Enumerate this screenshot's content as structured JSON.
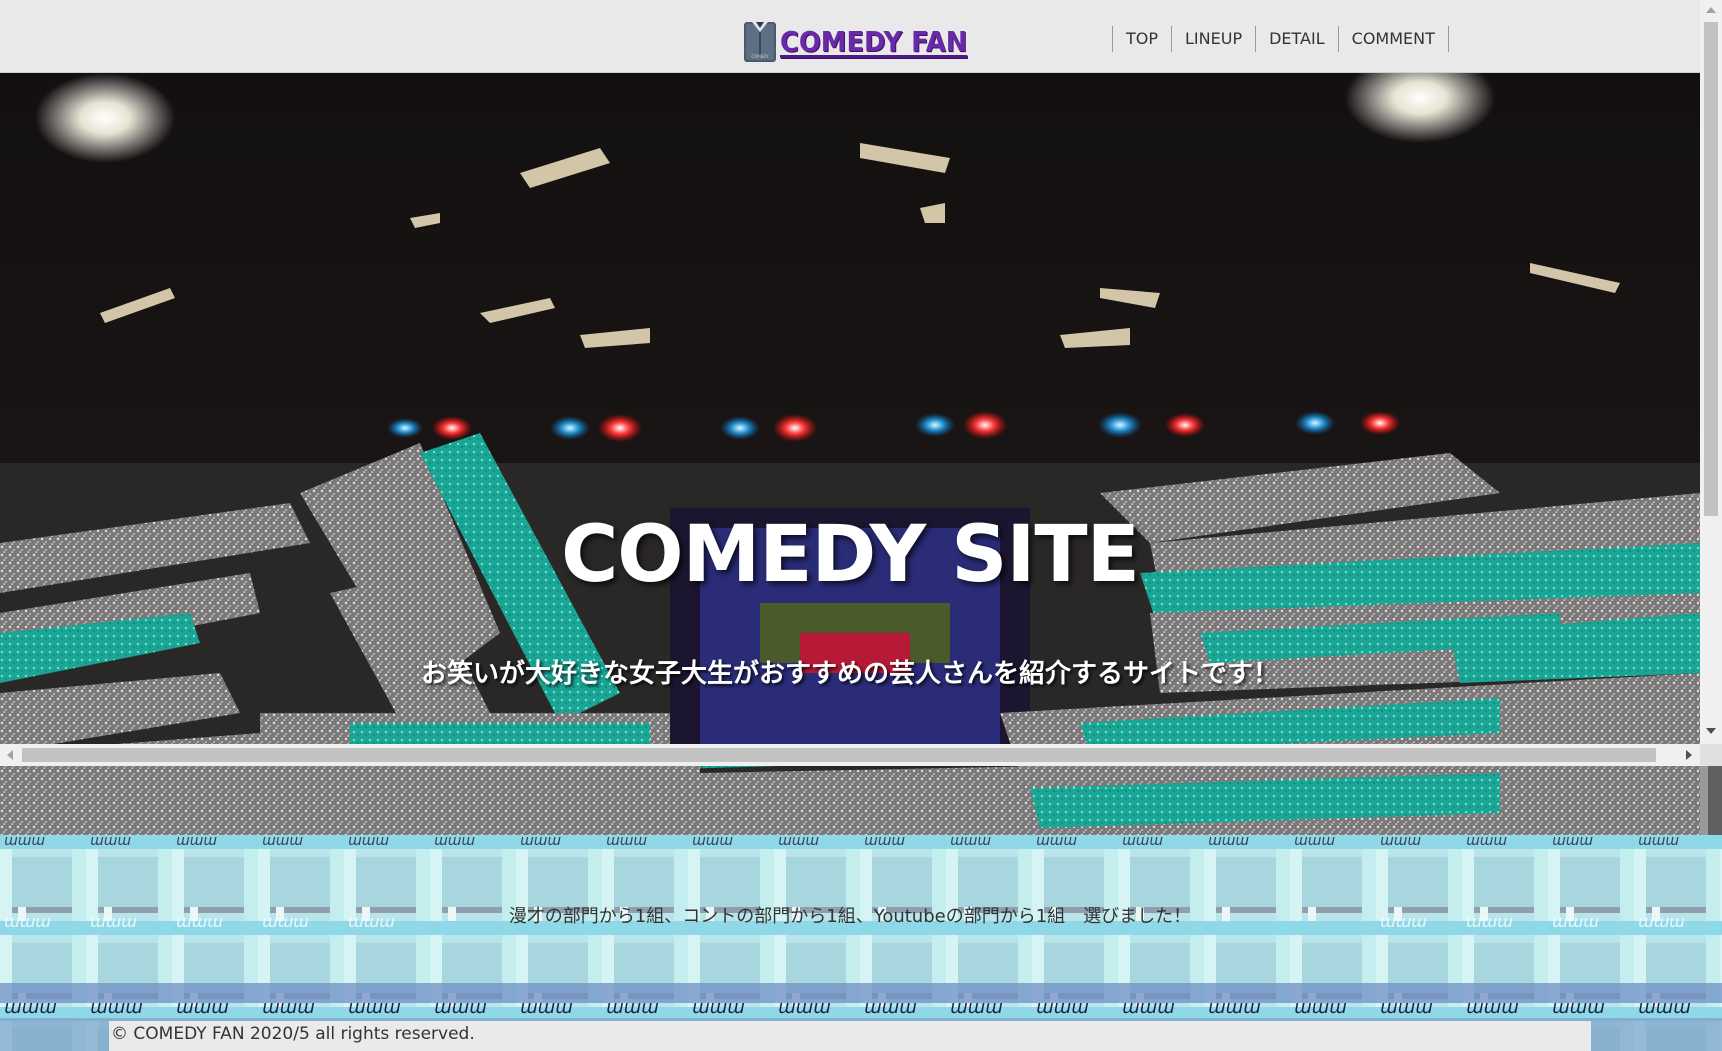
{
  "header": {
    "logo_text": "COMEDY FAN",
    "nav": [
      "TOP",
      "LINEUP",
      "DETAIL",
      "COMMENT"
    ]
  },
  "hero": {
    "title": "COMEDY SITE",
    "subtitle": "お笑いが大好きな女子大生がおすすめの芸人さんを紹介するサイトです！"
  },
  "intro": {
    "text": "漫才の部門から1組、コントの部門から1組、Youtubeの部門から1組　選びました！",
    "pattern_label": "www"
  },
  "footer": {
    "copyright": "© COMEDY FAN 2020/5 all rights reserved."
  },
  "colors": {
    "logo": "#6a2aa8",
    "pattern_base": "#b4e4e8",
    "pattern_dark": "#6d8fc4",
    "hero_teal": "#1fb3a2"
  }
}
